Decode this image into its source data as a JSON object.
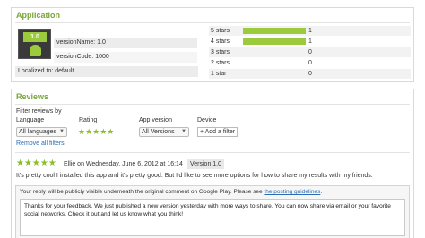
{
  "application": {
    "section_title": "Application",
    "icon_badge": "1.0",
    "version_name": "versionName: 1.0",
    "version_code": "versionCode: 1000",
    "localized": "Localized to: default",
    "ratings": [
      {
        "label": "5 stars",
        "count": "1",
        "fraction": 1.0
      },
      {
        "label": "4 stars",
        "count": "1",
        "fraction": 1.0
      },
      {
        "label": "3 stars",
        "count": "0",
        "fraction": 0
      },
      {
        "label": "2 stars",
        "count": "0",
        "fraction": 0
      },
      {
        "label": "1 star",
        "count": "0",
        "fraction": 0
      }
    ],
    "bar_color": "#9bcb3c"
  },
  "reviews": {
    "section_title": "Reviews",
    "filter_title": "Filter reviews by",
    "filters": {
      "language_label": "Language",
      "language_value": "All languages",
      "rating_label": "Rating",
      "rating_stars": "★★★★★",
      "app_version_label": "App version",
      "app_version_value": "All Versions",
      "device_label": "Device",
      "add_filter": "+ Add a filter"
    },
    "remove_all": "Remove all filters",
    "review": {
      "stars": "★★★★★",
      "author_date": "Ellie on Wednesday, June 6, 2012 at 16:14",
      "version": "Version 1.0",
      "body": "It's pretty cool I installed this app and it's pretty good. But I'd like to see more options for how to share my results with my friends."
    },
    "reply": {
      "note": "Your reply will be publicly visible underneath the original comment on Google Play. Please see",
      "guidelines_link": "the posting guidelines",
      "note_end": ".",
      "text": "Thanks for your feedback. We just published a new version yesterday with more ways to share. You can now share via email or your favorite social networks. Check it out and let us know what you think!"
    }
  }
}
